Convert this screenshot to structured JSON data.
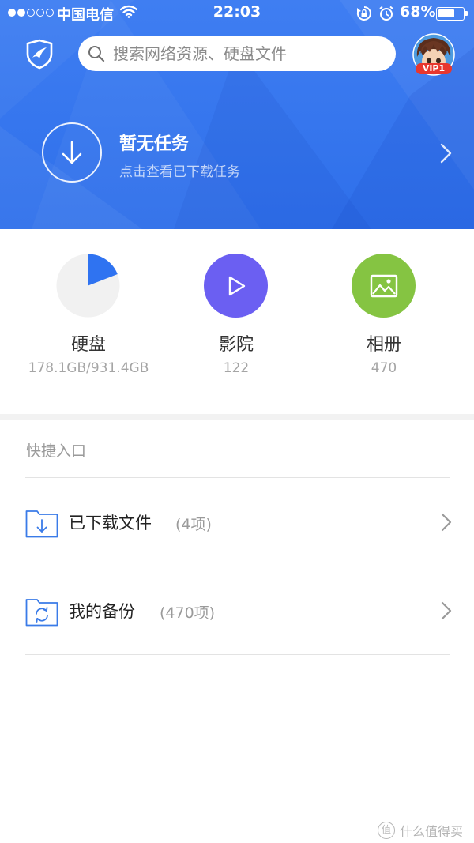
{
  "status_bar": {
    "carrier": "中国电信",
    "time": "22:03",
    "battery_percent": "68%",
    "battery_level": 0.68,
    "signal_bars": 2
  },
  "search": {
    "placeholder": "搜索网络资源、硬盘文件"
  },
  "user": {
    "vip_badge": "VIP1"
  },
  "task": {
    "title": "暂无任务",
    "subtitle": "点击查看已下载任务"
  },
  "grid": {
    "disk": {
      "label": "硬盘",
      "value": "178.1GB/931.4GB",
      "used_fraction": 0.191
    },
    "cinema": {
      "label": "影院",
      "value": "122"
    },
    "album": {
      "label": "相册",
      "value": "470"
    }
  },
  "shortcuts": {
    "title": "快捷入口",
    "items": [
      {
        "label": "已下载文件",
        "count": "(4项)",
        "icon": "folder-download-icon"
      },
      {
        "label": "我的备份",
        "count": "(470项)",
        "icon": "folder-sync-icon"
      }
    ]
  },
  "watermark": {
    "text": "什么值得买",
    "logo": "值"
  },
  "colors": {
    "header_blue": "#3275ee",
    "cinema_purple": "#6b5ff2",
    "album_green": "#85c442",
    "disk_used_blue": "#2f73f1",
    "disk_free_grey": "#f1f1f1"
  }
}
